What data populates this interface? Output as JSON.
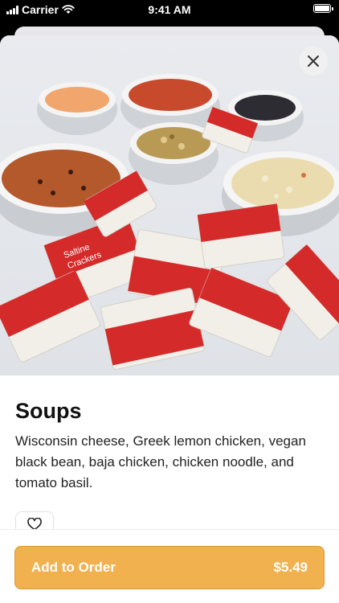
{
  "status_bar": {
    "carrier": "Carrier",
    "time": "9:41 AM"
  },
  "item": {
    "title": "Soups",
    "description": "Wisconsin cheese, Greek lemon chicken, vegan black bean, baja chicken, chicken noodle, and tomato basil.",
    "cracker_label_1": "Saltine",
    "cracker_label_2": "Crackers"
  },
  "order": {
    "label": "Add to Order",
    "price": "$5.49"
  },
  "colors": {
    "accent": "#f1b14f",
    "accent_border": "#d99a36"
  },
  "icons": [
    "close-icon",
    "heart-icon",
    "wifi-icon",
    "battery-icon",
    "signal-icon"
  ]
}
